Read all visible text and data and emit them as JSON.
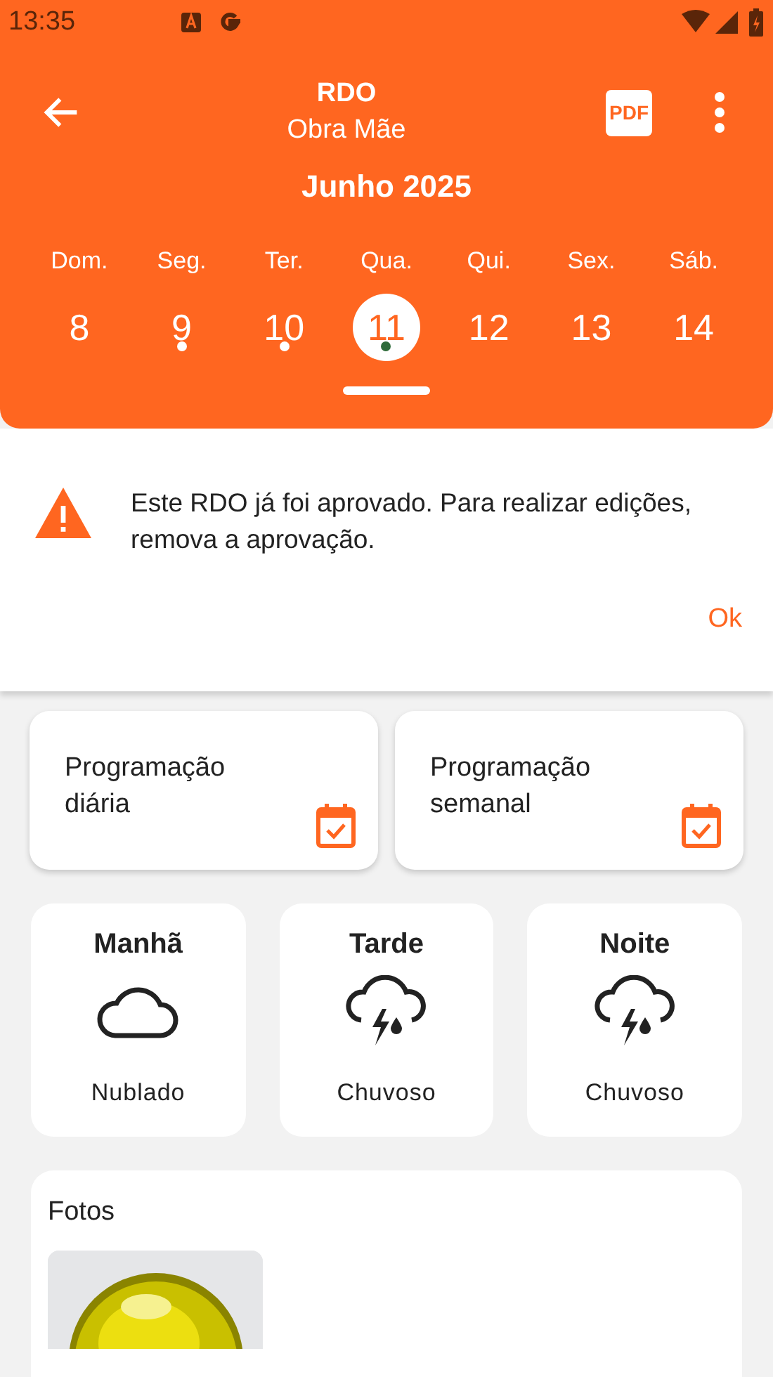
{
  "status_bar": {
    "time": "13:35"
  },
  "header": {
    "title": "RDO",
    "subtitle": "Obra Mãe",
    "pdf_label": "PDF",
    "month": "Junho 2025"
  },
  "days": [
    {
      "weekday": "Dom.",
      "date": "8",
      "selected": false,
      "has_entry": false
    },
    {
      "weekday": "Seg.",
      "date": "9",
      "selected": false,
      "has_entry": true
    },
    {
      "weekday": "Ter.",
      "date": "10",
      "selected": false,
      "has_entry": true
    },
    {
      "weekday": "Qua.",
      "date": "11",
      "selected": true,
      "has_entry": true
    },
    {
      "weekday": "Qui.",
      "date": "12",
      "selected": false,
      "has_entry": false
    },
    {
      "weekday": "Sex.",
      "date": "13",
      "selected": false,
      "has_entry": false
    },
    {
      "weekday": "Sáb.",
      "date": "14",
      "selected": false,
      "has_entry": false
    }
  ],
  "banner": {
    "message": "Este RDO já foi aprovado. Para realizar edições, remova a aprovação.",
    "action": "Ok"
  },
  "schedule_cards": [
    {
      "label": "Programação diária"
    },
    {
      "label": "Programação semanal"
    }
  ],
  "weather": [
    {
      "period": "Manhã",
      "kind": "cloudy",
      "condition": "Nublado"
    },
    {
      "period": "Tarde",
      "kind": "storm",
      "condition": "Chuvoso"
    },
    {
      "period": "Noite",
      "kind": "storm",
      "condition": "Chuvoso"
    }
  ],
  "photos": {
    "title": "Fotos"
  }
}
